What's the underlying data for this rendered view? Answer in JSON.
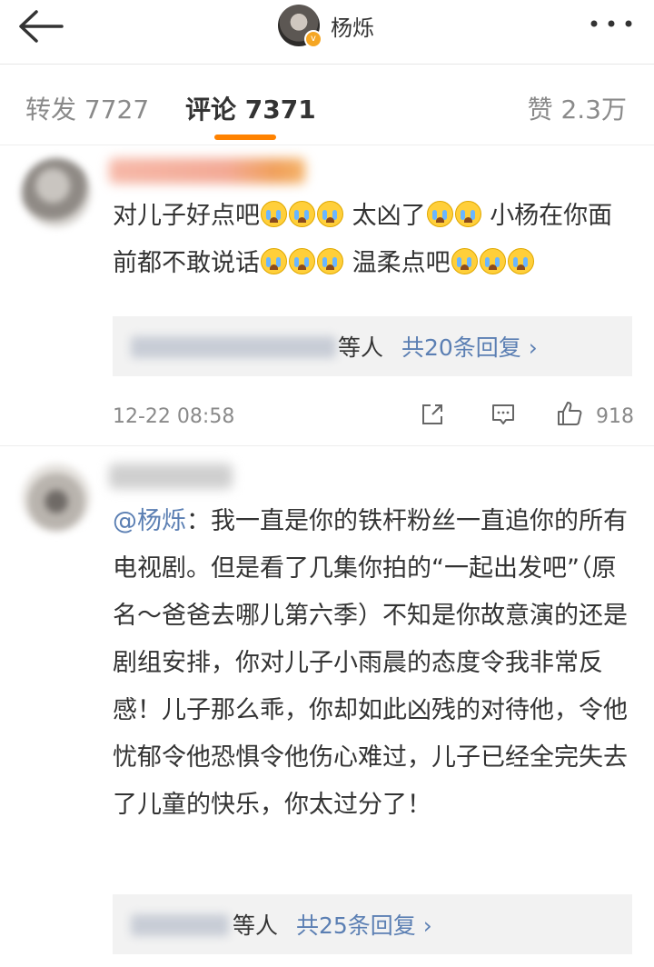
{
  "header": {
    "title": "杨烁",
    "back_icon": "arrow-left-icon",
    "more_icon": "more-dots-icon",
    "verified_badge": "v",
    "verified_color": "#f5a623"
  },
  "tabs": {
    "forward": "转发 7727",
    "comments": "评论 7371",
    "likes": "赞 2.3万",
    "active": "comments",
    "accent_color": "#ff8200"
  },
  "comments": [
    {
      "text_parts": [
        "对儿子好点吧",
        "太凶了",
        "小杨在你面前都不敢说话",
        "温柔点吧"
      ],
      "reply_etc": "等人",
      "reply_count": "共20条回复 ›",
      "timestamp": "12-22 08:58",
      "like_count": "918"
    },
    {
      "mention": "@杨烁",
      "text": "：我一直是你的铁杆粉丝一直追你的所有电视剧。但是看了几集你拍的“一起出发吧”（原名～爸爸去哪儿第六季）不知是你故意演的还是剧组安排，你对儿子小雨晨的态度令我非常反感！儿子那么乖，你却如此凶残的对待他，令他忧郁令他恐惧令他伤心难过，儿子已经全完失去了儿童的快乐，你太过分了！",
      "reply_etc": "等人",
      "reply_count": "共25条回复 ›"
    }
  ],
  "link_color": "#5b7fb3"
}
